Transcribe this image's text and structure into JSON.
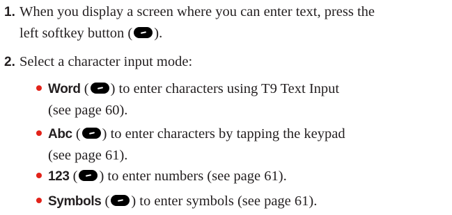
{
  "steps": [
    {
      "number": "1.",
      "text_line1": "When you display a screen where you can enter text, press the",
      "text_line2_before": "left softkey button (",
      "text_line2_after": ")."
    },
    {
      "number": "2.",
      "text": "Select a character input mode:"
    }
  ],
  "modes": [
    {
      "term": "Word",
      "before_icon": " (",
      "after_icon": ") to enter characters using T9 Text Input",
      "line2": "(see page 60)."
    },
    {
      "term": "Abc",
      "before_icon": " (",
      "after_icon": ") to enter characters by tapping the keypad",
      "line2": "(see page 61)."
    },
    {
      "term": "123",
      "before_icon": " (",
      "after_icon": ") to enter numbers (see page 61)."
    },
    {
      "term": "Symbols",
      "before_icon": " (",
      "after_icon": ") to enter symbols (see page 61)."
    }
  ],
  "icons": {
    "softkey": "left-softkey-icon"
  },
  "colors": {
    "text": "#231f20",
    "bullet": "#e2231a",
    "icon": "#000000"
  }
}
